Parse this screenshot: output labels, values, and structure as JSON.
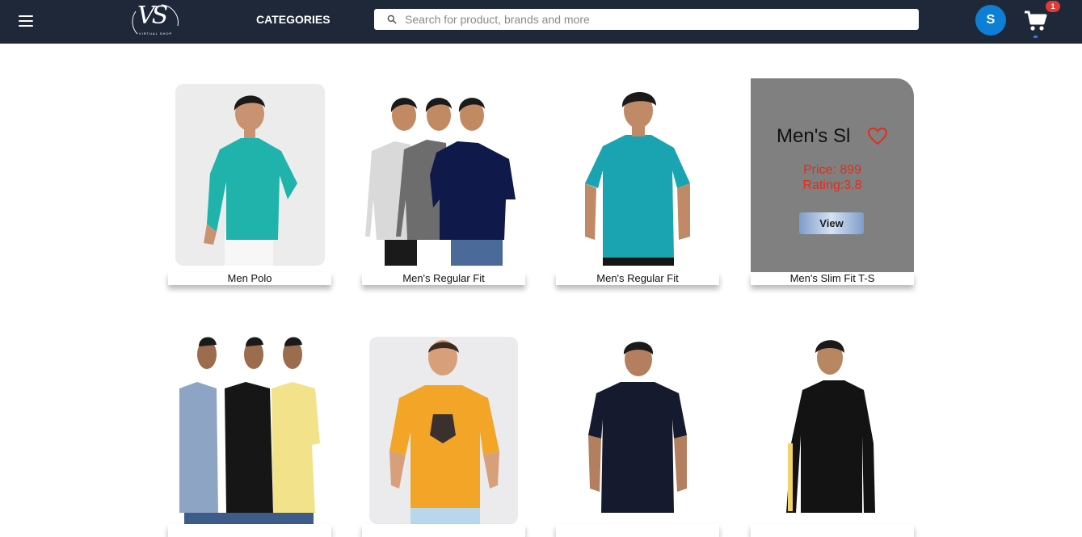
{
  "header": {
    "logo_text": "VS",
    "logo_sub": "VIRTUAL SHOP",
    "categories_label": "CATEGORIES",
    "search_placeholder": "Search for product, brands and more",
    "avatar_initial": "S",
    "cart_count": "1"
  },
  "products": [
    {
      "name": "Men Polo",
      "shirt_color": "#1fb3ac",
      "bg": "#ececec"
    },
    {
      "name": "Men's Regular Fit",
      "shirt_color": "#0f1a4a",
      "bg": "#ffffff"
    },
    {
      "name": "Men's Regular Fit",
      "shirt_color": "#1aa4b1",
      "bg": "#ffffff"
    },
    {
      "name": "Men's Slim Fit T-S",
      "hover_title": "Men's Sl",
      "price": "Price: 899",
      "rating": "Rating:3.8",
      "view_label": "View"
    },
    {
      "name": "",
      "shirt_color": "#8ea4c4",
      "bg": "#ffffff"
    },
    {
      "name": "",
      "shirt_color": "#f2a526",
      "bg": "#ebebed"
    },
    {
      "name": "",
      "shirt_color": "#151a2e",
      "bg": "#ffffff"
    },
    {
      "name": "",
      "shirt_color": "#131313",
      "bg": "#ffffff"
    }
  ],
  "colors": {
    "navbar": "#1f2838",
    "accent_blue": "#0d7fd4",
    "badge_red": "#e53935",
    "price_red": "#e02d1b"
  }
}
